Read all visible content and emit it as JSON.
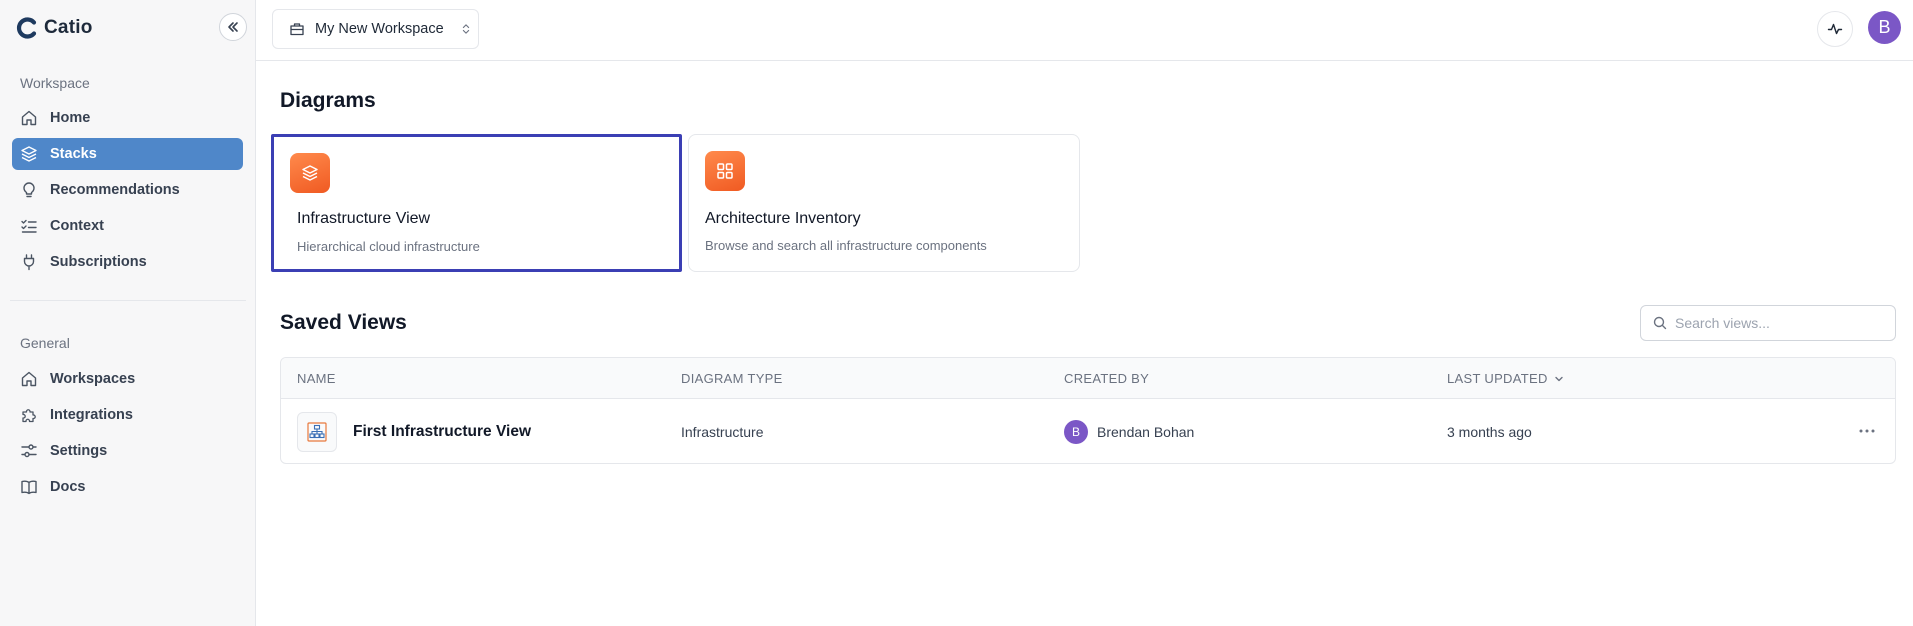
{
  "brand": {
    "name": "Catio"
  },
  "sidebar": {
    "workspace_label": "Workspace",
    "workspace_items": [
      {
        "label": "Home",
        "icon": "home-icon"
      },
      {
        "label": "Stacks",
        "icon": "layers-icon",
        "active": true
      },
      {
        "label": "Recommendations",
        "icon": "lightbulb-icon"
      },
      {
        "label": "Context",
        "icon": "list-checks-icon"
      },
      {
        "label": "Subscriptions",
        "icon": "plug-icon"
      }
    ],
    "general_label": "General",
    "general_items": [
      {
        "label": "Workspaces",
        "icon": "home-icon"
      },
      {
        "label": "Integrations",
        "icon": "puzzle-icon"
      },
      {
        "label": "Settings",
        "icon": "sliders-icon"
      },
      {
        "label": "Docs",
        "icon": "book-icon"
      }
    ]
  },
  "topbar": {
    "workspace_name": "My New Workspace",
    "avatar_initial": "B"
  },
  "diagrams": {
    "title": "Diagrams",
    "cards": [
      {
        "title": "Infrastructure View",
        "description": "Hierarchical cloud infrastructure",
        "icon": "layers-icon",
        "selected": true
      },
      {
        "title": "Architecture Inventory",
        "description": "Browse and search all infrastructure components",
        "icon": "grid-icon"
      }
    ]
  },
  "saved_views": {
    "title": "Saved Views",
    "search_placeholder": "Search views...",
    "columns": [
      "NAME",
      "DIAGRAM TYPE",
      "CREATED BY",
      "LAST UPDATED"
    ],
    "rows": [
      {
        "name": "First Infrastructure View",
        "diagram_type": "Infrastructure",
        "creator_initial": "B",
        "created_by": "Brendan Bohan",
        "last_updated": "3 months ago"
      }
    ]
  },
  "colors": {
    "accent": "#4f87c9",
    "selection_border": "#3b3fb4",
    "icon_orange": "#f26b2e",
    "avatar_purple": "#7b57c6"
  }
}
